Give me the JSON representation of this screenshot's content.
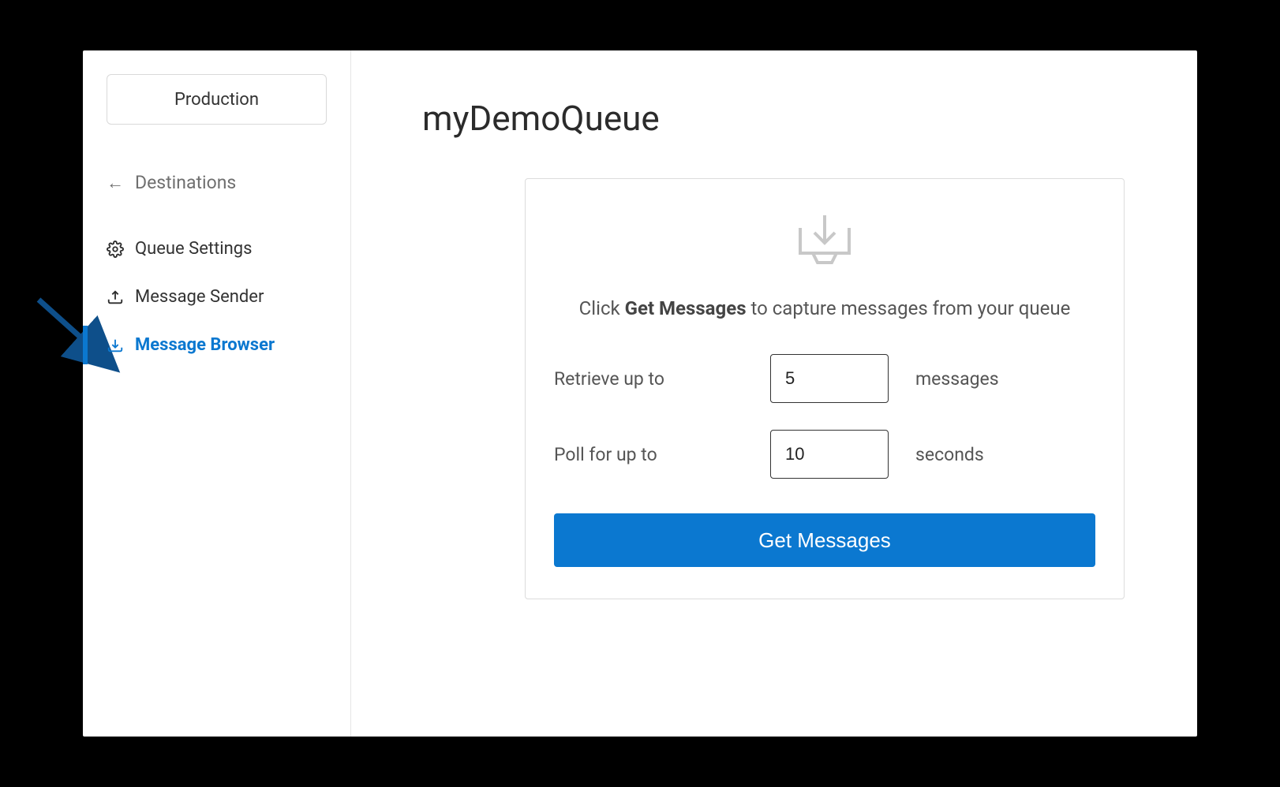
{
  "sidebar": {
    "environment_label": "Production",
    "back_label": "Destinations",
    "items": [
      {
        "label": "Queue Settings",
        "icon": "gear",
        "active": false
      },
      {
        "label": "Message Sender",
        "icon": "upload-tray",
        "active": false
      },
      {
        "label": "Message Browser",
        "icon": "download-tray",
        "active": true
      }
    ]
  },
  "main": {
    "page_title": "myDemoQueue",
    "hint_prefix": "Click ",
    "hint_strong": "Get Messages",
    "hint_suffix": " to capture messages from your queue",
    "retrieve_label_left": "Retrieve up to",
    "retrieve_value": "5",
    "retrieve_label_right": "messages",
    "poll_label_left": "Poll for up to",
    "poll_value": "10",
    "poll_label_right": "seconds",
    "get_button_label": "Get Messages"
  },
  "colors": {
    "accent": "#0b78d0"
  }
}
